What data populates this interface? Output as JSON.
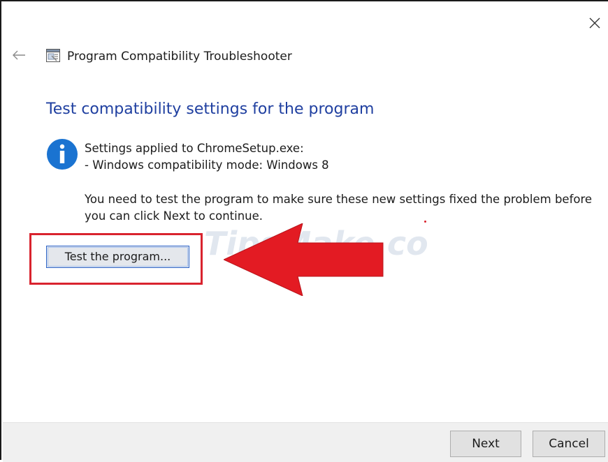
{
  "window": {
    "title": "Program Compatibility Troubleshooter",
    "close_icon": "close-icon",
    "back_icon": "back-arrow-icon",
    "app_icon": "troubleshooter-icon"
  },
  "main": {
    "heading": "Test compatibility settings for the program",
    "info_icon": "info-icon",
    "settings_line1": "Settings applied to ChromeSetup.exe:",
    "settings_line2": "- Windows compatibility mode: Windows 8",
    "instruction_line1": "You need to test the program to make sure these new settings fixed the problem before",
    "instruction_line2": "you can click Next to continue.",
    "test_button_label": "Test the program..."
  },
  "annotation": {
    "watermark": "TipsMake.com",
    "highlight_color": "#d9232e",
    "arrow_color": "#e31b23"
  },
  "footer": {
    "next_label": "Next",
    "cancel_label": "Cancel"
  },
  "colors": {
    "heading": "#1f3fa0",
    "info_icon": "#1a73d1"
  }
}
